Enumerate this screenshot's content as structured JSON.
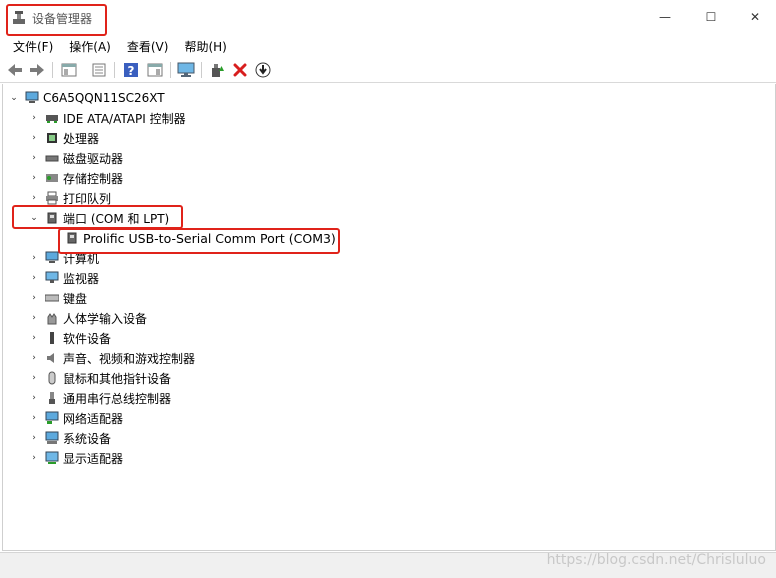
{
  "window": {
    "title": "设备管理器",
    "minimize_glyph": "—",
    "maximize_glyph": "☐",
    "close_glyph": "✕"
  },
  "menu": [
    "文件(F)",
    "操作(A)",
    "查看(V)",
    "帮助(H)"
  ],
  "toolbar": {
    "icons": [
      "back-icon",
      "forward-icon",
      "show-hide-tree-icon",
      "properties-icon",
      "help-icon",
      "action-pane-icon",
      "monitor-icon",
      "update-driver-icon",
      "uninstall-icon",
      "download-icon"
    ]
  },
  "tree": {
    "root": "C6A5QQN11SC26XT",
    "categories": [
      {
        "label": "IDE ATA/ATAPI 控制器",
        "icon": "ide-controller-icon"
      },
      {
        "label": "处理器",
        "icon": "processor-icon"
      },
      {
        "label": "磁盘驱动器",
        "icon": "disk-drive-icon"
      },
      {
        "label": "存储控制器",
        "icon": "storage-controller-icon"
      },
      {
        "label": "打印队列",
        "icon": "printer-icon"
      },
      {
        "label": "端口 (COM 和 LPT)",
        "icon": "port-icon",
        "expanded": true
      },
      {
        "label": "计算机",
        "icon": "computer-icon"
      },
      {
        "label": "监视器",
        "icon": "monitor-icon"
      },
      {
        "label": "键盘",
        "icon": "keyboard-icon"
      },
      {
        "label": "人体学输入设备",
        "icon": "hid-icon"
      },
      {
        "label": "软件设备",
        "icon": "software-device-icon"
      },
      {
        "label": "声音、视频和游戏控制器",
        "icon": "sound-icon"
      },
      {
        "label": "鼠标和其他指针设备",
        "icon": "mouse-icon"
      },
      {
        "label": "通用串行总线控制器",
        "icon": "usb-icon"
      },
      {
        "label": "网络适配器",
        "icon": "network-adapter-icon"
      },
      {
        "label": "系统设备",
        "icon": "system-device-icon"
      },
      {
        "label": "显示适配器",
        "icon": "display-adapter-icon"
      }
    ],
    "port_child": "Prolific USB-to-Serial Comm Port (COM3)"
  },
  "watermark": "https://blog.csdn.net/Chrisluluo",
  "colors": {
    "highlight": "#e0231a"
  }
}
